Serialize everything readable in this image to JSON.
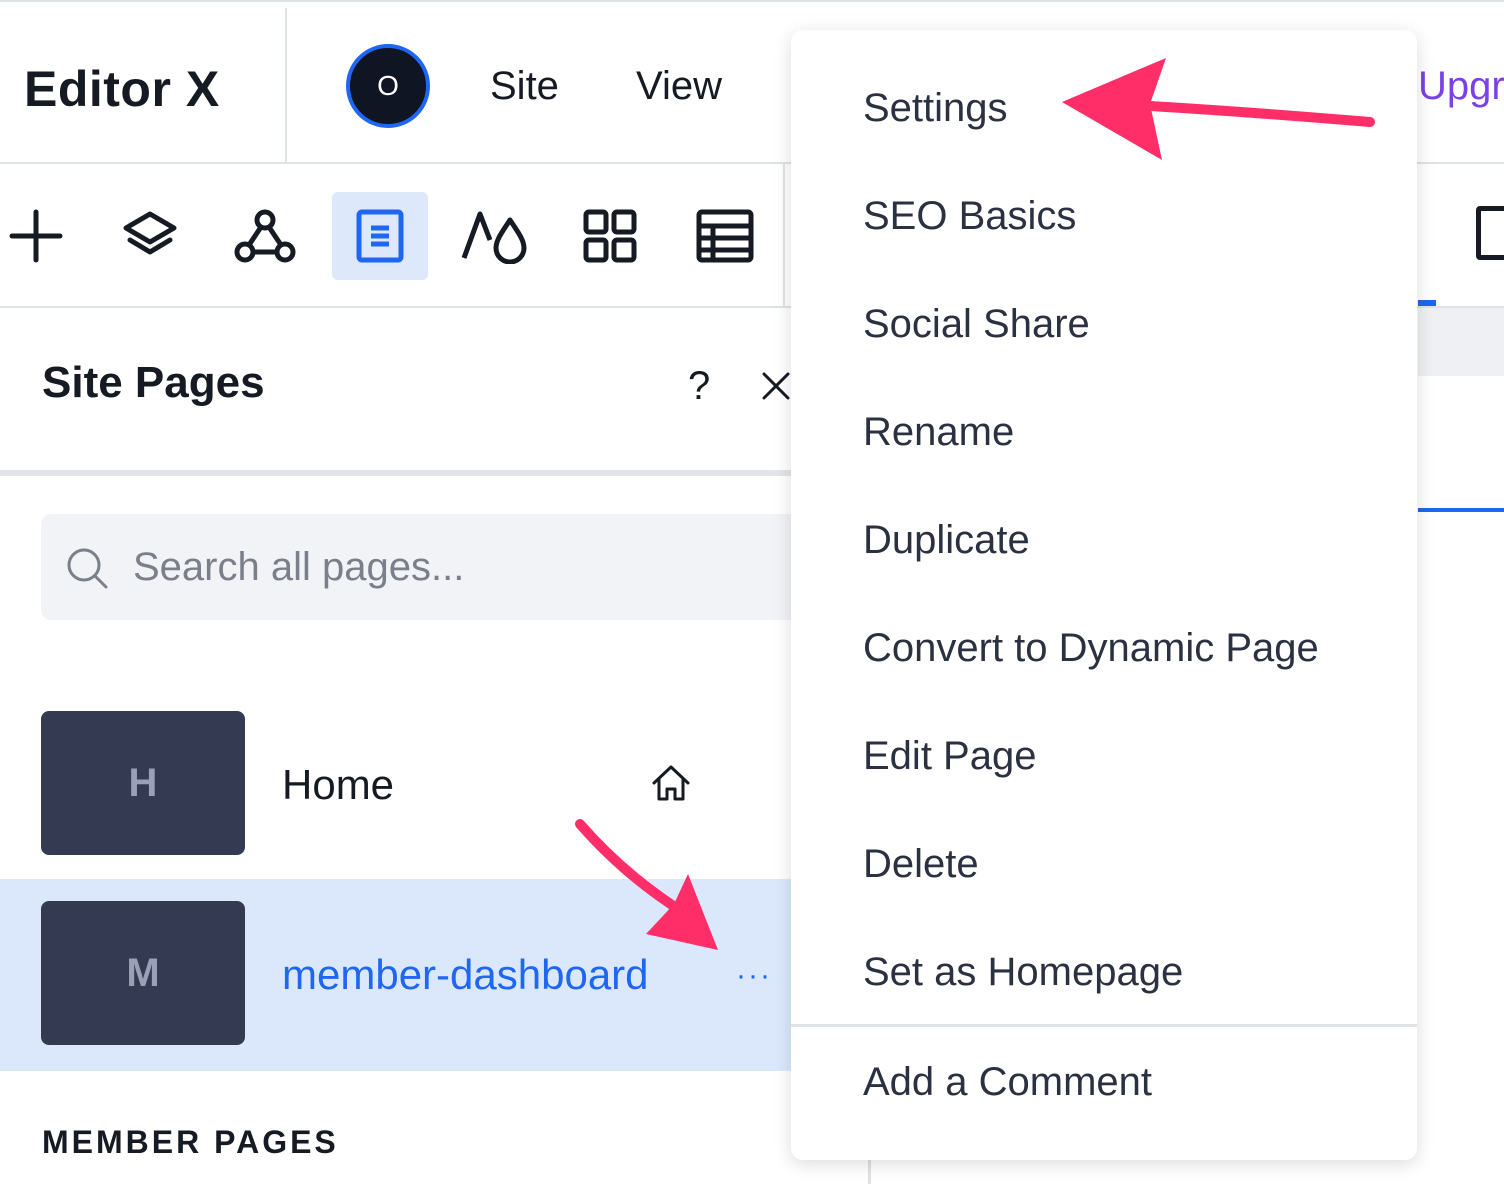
{
  "app": {
    "brand": "Editor X",
    "avatar_letter": "O",
    "menu": [
      "Site",
      "View"
    ],
    "upgrade_label": "Upgrade"
  },
  "toolbar": {
    "tools": [
      {
        "icon": "plus-icon"
      },
      {
        "icon": "layers-icon"
      },
      {
        "icon": "connections-icon"
      },
      {
        "icon": "pages-icon",
        "active": true
      },
      {
        "icon": "theme-icon"
      },
      {
        "icon": "apps-grid-icon"
      },
      {
        "icon": "table-icon"
      }
    ]
  },
  "panel": {
    "title": "Site Pages",
    "help": "?",
    "search_placeholder": "Search all pages...",
    "pages": [
      {
        "letter": "H",
        "name": "Home",
        "is_home": true
      },
      {
        "letter": "M",
        "name": "member-dashboard",
        "selected": true,
        "more": "···"
      }
    ],
    "section_label": "MEMBER PAGES"
  },
  "context_menu": {
    "items": [
      "Settings",
      "SEO Basics",
      "Social Share",
      "Rename",
      "Duplicate",
      "Convert to Dynamic Page",
      "Edit Page",
      "Delete",
      "Set as Homepage"
    ],
    "footer_item": "Add a Comment"
  },
  "colors": {
    "accent": "#1f66f2",
    "annotation_arrow": "#ff2e68",
    "selected_row": "#dbe8fc",
    "thumb": "#353a53"
  }
}
